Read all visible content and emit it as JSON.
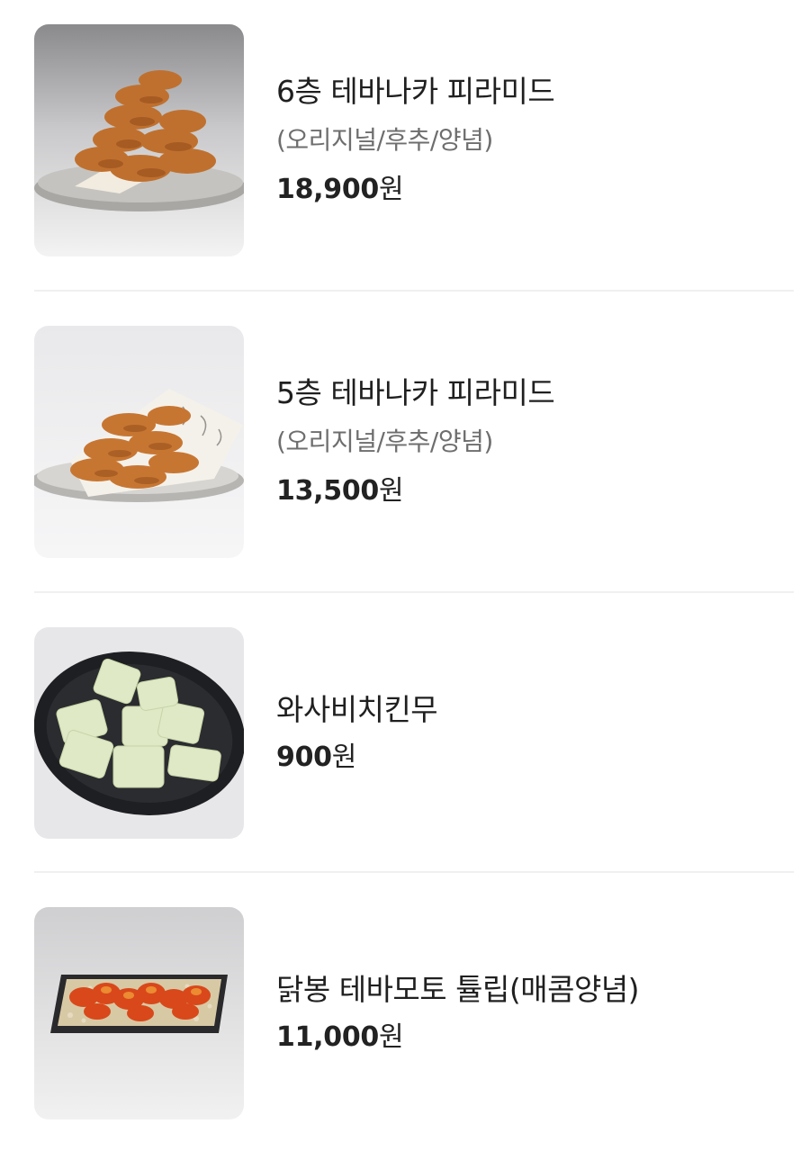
{
  "menu": {
    "items": [
      {
        "name": "6층 테바나카 피라미드",
        "options": "(오리지널/후추/양념)",
        "price_number": "18,900",
        "price_unit": "원",
        "image_icon": "fried-chicken-wings-pyramid-photo"
      },
      {
        "name": "5층 테바나카 피라미드",
        "options": "(오리지널/후추/양념)",
        "price_number": "13,500",
        "price_unit": "원",
        "image_icon": "fried-chicken-wings-photo"
      },
      {
        "name": "와사비치킨무",
        "options": "",
        "price_number": "900",
        "price_unit": "원",
        "image_icon": "pickled-radish-bowl-photo"
      },
      {
        "name": "닭봉 테바모토 튤립(매콤양념)",
        "options": "",
        "price_number": "11,000",
        "price_unit": "원",
        "image_icon": "spicy-drumstick-tulip-platter-photo"
      }
    ]
  },
  "colors": {
    "text_primary": "#1f1f1f",
    "text_secondary": "#6e6e6e",
    "divider": "#f0f0f2",
    "background": "#ffffff"
  }
}
